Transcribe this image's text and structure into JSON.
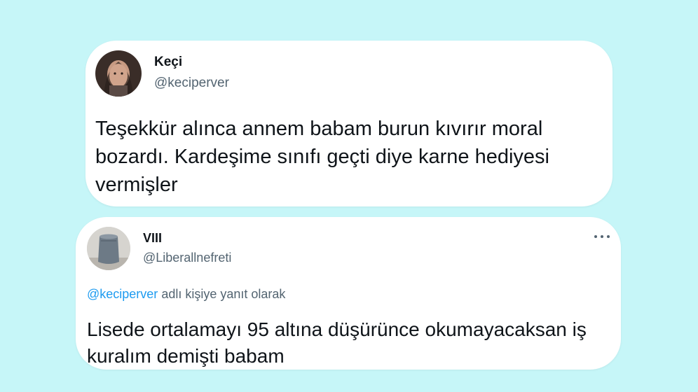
{
  "tweets": [
    {
      "name": "Keçi",
      "handle": "@keciperver",
      "text": "Teşekkür alınca annem babam burun kıvırır moral bozardı. Kardeşime sınıfı geçti diye karne hediyesi vermişler"
    },
    {
      "name": "VIII",
      "handle": "@Liberallnefreti",
      "reply_mention": "@keciperver",
      "reply_suffix": " adlı kişiye yanıt olarak",
      "text": "Lisede ortalamayı 95 altına düşürünce okumayacaksan iş kuralım demişti babam"
    }
  ],
  "colors": {
    "background": "#c6f6f8",
    "card": "#ffffff",
    "primary_text": "#0f1419",
    "secondary_text": "#536471",
    "mention": "#1d9bf0"
  },
  "icons": {
    "more": "more-options-icon"
  }
}
